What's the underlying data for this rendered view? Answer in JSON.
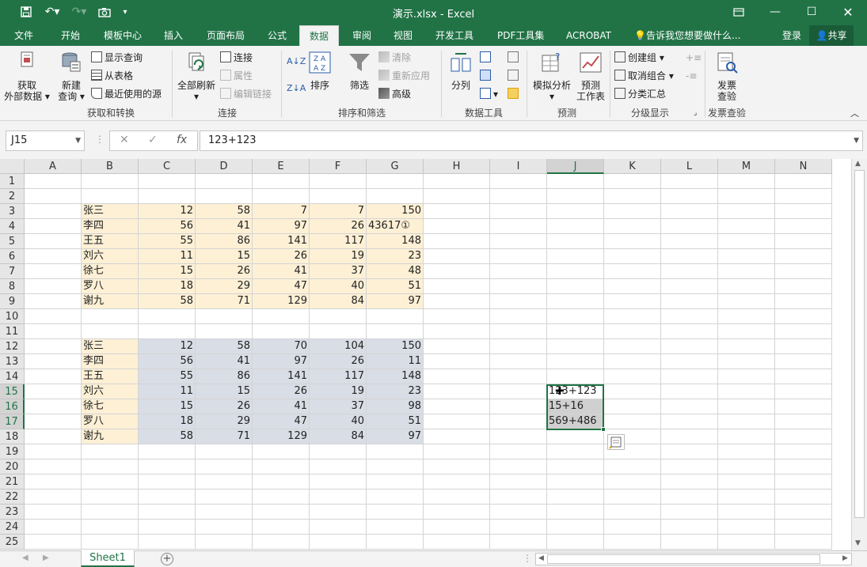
{
  "window": {
    "title": "演示.xlsx - Excel",
    "login": "登录",
    "share": "共享",
    "tell_me": "告诉我您想要做什么..."
  },
  "tabs": [
    {
      "label": "文件"
    },
    {
      "label": "开始"
    },
    {
      "label": "模板中心"
    },
    {
      "label": "插入"
    },
    {
      "label": "页面布局"
    },
    {
      "label": "公式"
    },
    {
      "label": "数据"
    },
    {
      "label": "审阅"
    },
    {
      "label": "视图"
    },
    {
      "label": "开发工具"
    },
    {
      "label": "PDF工具集"
    },
    {
      "label": "ACROBAT"
    }
  ],
  "ribbon": {
    "get_data_line1": "获取",
    "get_data_line2": "外部数据",
    "new_query_line1": "新建",
    "new_query_line2": "查询",
    "show_query": "显示查询",
    "from_table": "从表格",
    "recent_sources": "最近使用的源",
    "group_get_transform": "获取和转换",
    "refresh_all": "全部刷新",
    "connections": "连接",
    "properties": "属性",
    "edit_links": "编辑链接",
    "group_connections": "连接",
    "sort_az": "A↓Z",
    "sort_za": "Z↓A",
    "sort": "排序",
    "filter": "筛选",
    "clear": "清除",
    "reapply": "重新应用",
    "advanced": "高级",
    "group_sort_filter": "排序和筛选",
    "text_to_columns": "分列",
    "group_data_tools": "数据工具",
    "what_if": "模拟分析",
    "forecast_line1": "预测",
    "forecast_line2": "工作表",
    "group_forecast": "预测",
    "group": "创建组",
    "ungroup": "取消组合",
    "subtotal": "分类汇总",
    "group_outline": "分级显示",
    "invoice_line1": "发票",
    "invoice_line2": "查验",
    "group_invoice": "发票查验"
  },
  "formula_bar": {
    "name_box": "J15",
    "formula": "123+123",
    "fx": "fx"
  },
  "columns": [
    "A",
    "B",
    "C",
    "D",
    "E",
    "F",
    "G",
    "H",
    "I",
    "J",
    "K",
    "L",
    "M",
    "N"
  ],
  "rows": [
    "1",
    "2",
    "3",
    "4",
    "5",
    "6",
    "7",
    "8",
    "9",
    "10",
    "11",
    "12",
    "13",
    "14",
    "15",
    "16",
    "17",
    "18",
    "19",
    "20",
    "21",
    "22",
    "23",
    "24",
    "25"
  ],
  "table1": [
    {
      "name": "张三",
      "c": "12",
      "d": "58",
      "e": "7",
      "f": "7",
      "g": "150"
    },
    {
      "name": "李四",
      "c": "56",
      "d": "41",
      "e": "97",
      "f": "26",
      "g": "43617①"
    },
    {
      "name": "王五",
      "c": "55",
      "d": "86",
      "e": "141",
      "f": "117",
      "g": "148"
    },
    {
      "name": "刘六",
      "c": "11",
      "d": "15",
      "e": "26",
      "f": "19",
      "g": "23"
    },
    {
      "name": "徐七",
      "c": "15",
      "d": "26",
      "e": "41",
      "f": "37",
      "g": "48"
    },
    {
      "name": "罗八",
      "c": "18",
      "d": "29",
      "e": "47",
      "f": "40",
      "g": "51"
    },
    {
      "name": "谢九",
      "c": "58",
      "d": "71",
      "e": "129",
      "f": "84",
      "g": "97"
    }
  ],
  "table2": [
    {
      "name": "张三",
      "c": "12",
      "d": "58",
      "e": "70",
      "f": "104",
      "g": "150"
    },
    {
      "name": "李四",
      "c": "56",
      "d": "41",
      "e": "97",
      "f": "26",
      "g": "11"
    },
    {
      "name": "王五",
      "c": "55",
      "d": "86",
      "e": "141",
      "f": "117",
      "g": "148"
    },
    {
      "name": "刘六",
      "c": "11",
      "d": "15",
      "e": "26",
      "f": "19",
      "g": "23"
    },
    {
      "name": "徐七",
      "c": "15",
      "d": "26",
      "e": "41",
      "f": "37",
      "g": "98"
    },
    {
      "name": "罗八",
      "c": "18",
      "d": "29",
      "e": "47",
      "f": "40",
      "g": "51"
    },
    {
      "name": "谢九",
      "c": "58",
      "d": "71",
      "e": "129",
      "f": "84",
      "g": "97"
    }
  ],
  "j_cells": [
    "123+123",
    "15+16",
    "569+486"
  ],
  "sheet_tab": "Sheet1",
  "colors": {
    "excel_green": "#217346",
    "name_fill": "#fdf0d5",
    "table2_fill": "#d9dde6"
  }
}
